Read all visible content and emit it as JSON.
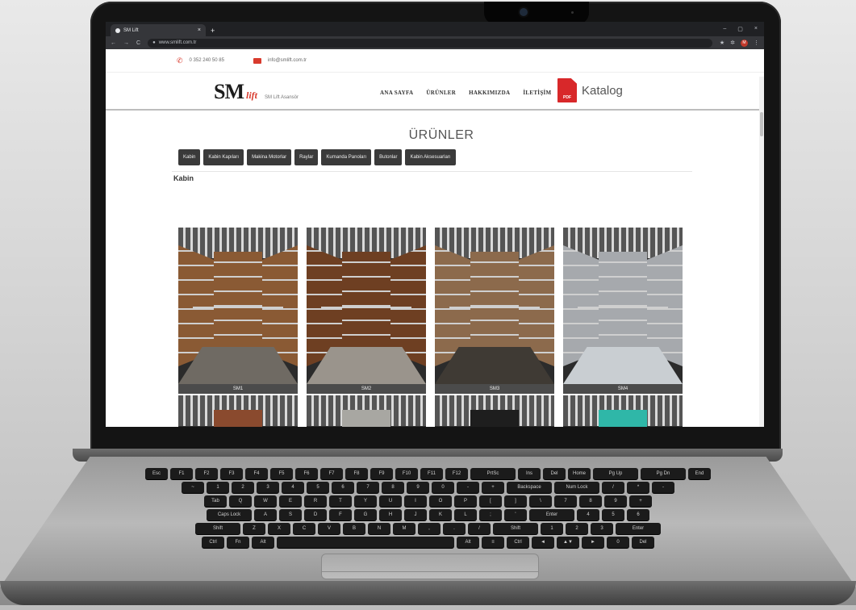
{
  "browser": {
    "tab_title": "SM Lift",
    "tab_close": "×",
    "new_tab": "+",
    "window_controls": [
      "–",
      "▢",
      "×"
    ],
    "nav_buttons": [
      "←",
      "→",
      "C"
    ],
    "url": "www.smlift.com.tr",
    "toolbar_icons": [
      "★",
      "✲",
      "⋮"
    ],
    "profile_initial": "M"
  },
  "contact": {
    "phone": "0 352 240 50 85",
    "email": "info@smlift.com.tr"
  },
  "header": {
    "logo_main": "SM",
    "logo_lift": "lift",
    "logo_sub": "SM Lift Asansör",
    "nav": [
      "ANA SAYFA",
      "ÜRÜNLER",
      "HAKKIMIZDA",
      "İLETİŞİM"
    ],
    "katalog_label": "Katalog",
    "pdf_badge": "PDF"
  },
  "main": {
    "section_title": "ÜRÜNLER",
    "categories": [
      "Kabin",
      "Kabin Kapıları",
      "Makina Motorlar",
      "Raylar",
      "Kumanda Panoları",
      "Butonlar",
      "Kabin Aksesuarları"
    ],
    "sub_title": "Kabin",
    "products": [
      {
        "caption": "SM1",
        "wall": "#8a5a34",
        "floor": "#6f6a63"
      },
      {
        "caption": "SM2",
        "wall": "#6e3f22",
        "floor": "#9a948c"
      },
      {
        "caption": "SM3",
        "wall": "#8c6a4c",
        "floor": "#3f3a34"
      },
      {
        "caption": "SM4",
        "wall": "#a6a9ad",
        "floor": "#c9ced2"
      }
    ],
    "products_row2": [
      {
        "wall": "#8a4a2e"
      },
      {
        "wall": "#a8a7a2"
      },
      {
        "wall": "#1e1e1e"
      },
      {
        "wall": "#2fb7a8"
      }
    ]
  },
  "keyboard": {
    "row1": [
      "Esc",
      "F1",
      "F2",
      "F3",
      "F4",
      "F5",
      "F6",
      "F7",
      "F8",
      "F9",
      "F10",
      "F11",
      "F12",
      "PrtSc",
      "Ins",
      "Del",
      "Home",
      "Pg Up",
      "Pg Dn",
      "End"
    ],
    "row2": [
      "~",
      "1",
      "2",
      "3",
      "4",
      "5",
      "6",
      "7",
      "8",
      "9",
      "0",
      "-",
      "+",
      "Backspace",
      "Num Lock",
      "/",
      "*",
      "-"
    ],
    "row3": [
      "Tab",
      "Q",
      "W",
      "E",
      "R",
      "T",
      "Y",
      "U",
      "I",
      "O",
      "P",
      "[",
      "]",
      "\\",
      "7",
      "8",
      "9",
      "+"
    ],
    "row4": [
      "Caps Lock",
      "A",
      "S",
      "D",
      "F",
      "G",
      "H",
      "J",
      "K",
      "L",
      ";",
      "'",
      "Enter",
      "4",
      "5",
      "6"
    ],
    "row5": [
      "Shift",
      "Z",
      "X",
      "C",
      "V",
      "B",
      "N",
      "M",
      ",",
      ".",
      "/",
      "Shift",
      "1",
      "2",
      "3",
      "Enter"
    ],
    "row6": [
      "Ctrl",
      "Fn",
      "Alt",
      "",
      "Alt",
      "≡",
      "Ctrl",
      "◄",
      "▲▼",
      "►",
      "0",
      "Del"
    ]
  },
  "colors": {
    "accent_red": "#d83a2d",
    "category_button": "#3a3a3a"
  }
}
